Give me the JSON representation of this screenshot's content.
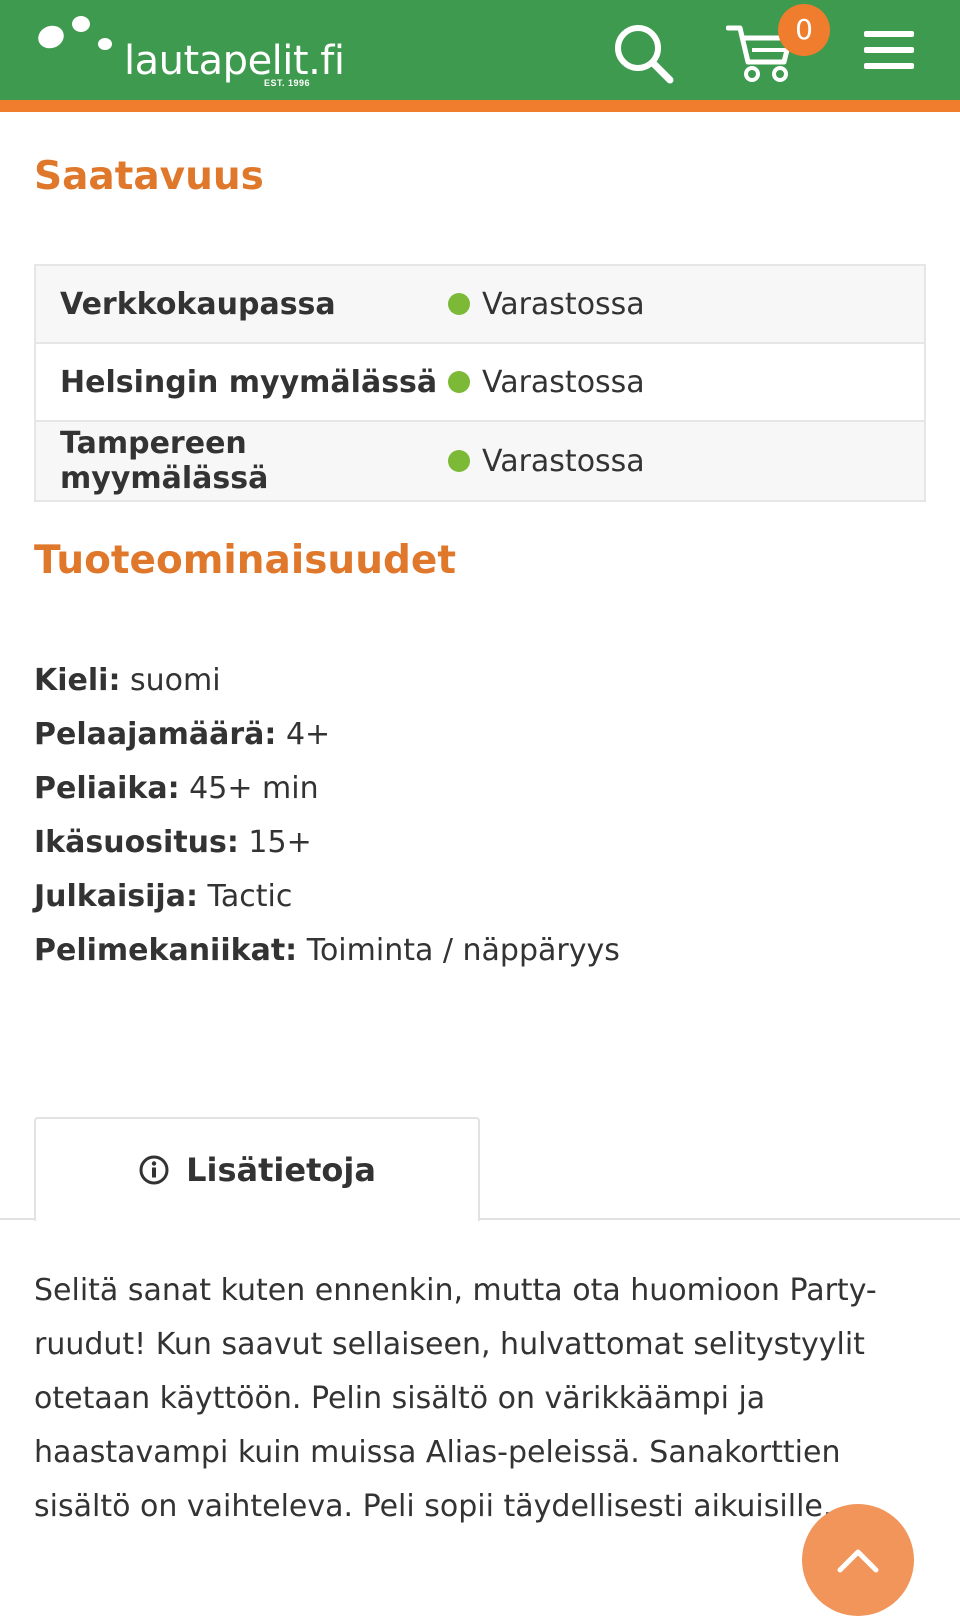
{
  "header": {
    "logo_text": "lautapelit.fi",
    "logo_est": "EST. 1996",
    "cart_count": "0",
    "icons": [
      "search-icon",
      "cart-icon",
      "menu-icon"
    ],
    "colors": {
      "brand_green": "#3e9a4f",
      "accent_orange": "#ef7d2d"
    }
  },
  "availability": {
    "title": "Saatavuus",
    "rows": [
      {
        "location": "Verkkokaupassa",
        "status": "Varastossa"
      },
      {
        "location": "Helsingin myymälässä",
        "status": "Varastossa"
      },
      {
        "location": "Tampereen myymälässä",
        "status": "Varastossa"
      }
    ],
    "status_color": "#7cb937"
  },
  "properties": {
    "title": "Tuoteominaisuudet",
    "items": [
      {
        "key": "Kieli:",
        "value": "suomi"
      },
      {
        "key": "Pelaajamäärä:",
        "value": "4+"
      },
      {
        "key": "Peliaika:",
        "value": "45+ min"
      },
      {
        "key": "Ikäsuositus:",
        "value": "15+"
      },
      {
        "key": "Julkaisija:",
        "value": "Tactic"
      },
      {
        "key": "Pelimekaniikat:",
        "value": "Toiminta / näppäryys"
      }
    ]
  },
  "tabs": [
    {
      "label": "Lisätietoja",
      "icon": "info-icon",
      "active": true
    }
  ],
  "description": "Selitä sanat kuten ennenkin, mutta ota huomioon Party-ruudut! Kun saavut sellaiseen, hulvattomat selitystyylit otetaan käyttöön. Pelin sisältö on värikkäämpi ja haastavampi kuin muissa Alias-peleissä. Sanakorttien sisältö on vaihteleva. Peli sopii täydellisesti aikuisille.",
  "scroll_top": {
    "icon": "chevron-up-icon"
  }
}
